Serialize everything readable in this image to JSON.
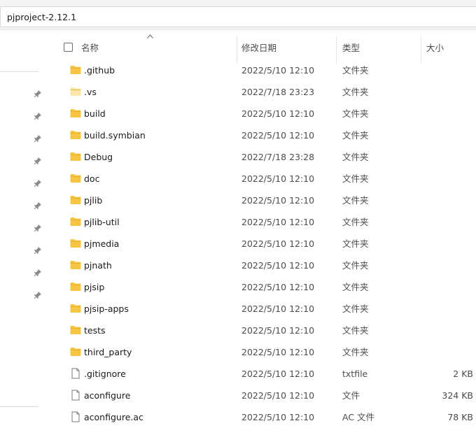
{
  "address": {
    "path": "pjproject-2.12.1"
  },
  "columns": {
    "name": "名称",
    "date": "修改日期",
    "type": "类型",
    "size": "大小"
  },
  "colors": {
    "folder": "#f6c544",
    "folder_light": "#fbe6a8",
    "accent": "#0067c0"
  },
  "rows": [
    {
      "name": ".github",
      "date": "2022/5/10 12:10",
      "type": "文件夹",
      "size": "",
      "icon": "folder-icon"
    },
    {
      "name": ".vs",
      "date": "2022/7/18 23:23",
      "type": "文件夹",
      "size": "",
      "icon": "folder-hidden-icon"
    },
    {
      "name": "build",
      "date": "2022/5/10 12:10",
      "type": "文件夹",
      "size": "",
      "icon": "folder-icon"
    },
    {
      "name": "build.symbian",
      "date": "2022/5/10 12:10",
      "type": "文件夹",
      "size": "",
      "icon": "folder-icon"
    },
    {
      "name": "Debug",
      "date": "2022/7/18 23:28",
      "type": "文件夹",
      "size": "",
      "icon": "folder-icon"
    },
    {
      "name": "doc",
      "date": "2022/5/10 12:10",
      "type": "文件夹",
      "size": "",
      "icon": "folder-icon"
    },
    {
      "name": "pjlib",
      "date": "2022/5/10 12:10",
      "type": "文件夹",
      "size": "",
      "icon": "folder-icon"
    },
    {
      "name": "pjlib-util",
      "date": "2022/5/10 12:10",
      "type": "文件夹",
      "size": "",
      "icon": "folder-icon"
    },
    {
      "name": "pjmedia",
      "date": "2022/5/10 12:10",
      "type": "文件夹",
      "size": "",
      "icon": "folder-icon"
    },
    {
      "name": "pjnath",
      "date": "2022/5/10 12:10",
      "type": "文件夹",
      "size": "",
      "icon": "folder-icon"
    },
    {
      "name": "pjsip",
      "date": "2022/5/10 12:10",
      "type": "文件夹",
      "size": "",
      "icon": "folder-icon"
    },
    {
      "name": "pjsip-apps",
      "date": "2022/5/10 12:10",
      "type": "文件夹",
      "size": "",
      "icon": "folder-icon"
    },
    {
      "name": "tests",
      "date": "2022/5/10 12:10",
      "type": "文件夹",
      "size": "",
      "icon": "folder-icon"
    },
    {
      "name": "third_party",
      "date": "2022/5/10 12:10",
      "type": "文件夹",
      "size": "",
      "icon": "folder-icon"
    },
    {
      "name": ".gitignore",
      "date": "2022/5/10 12:10",
      "type": "txtfile",
      "size": "2 KB",
      "icon": "file-icon"
    },
    {
      "name": "aconfigure",
      "date": "2022/5/10 12:10",
      "type": "文件",
      "size": "324 KB",
      "icon": "file-icon"
    },
    {
      "name": "aconfigure.ac",
      "date": "2022/5/10 12:10",
      "type": "AC 文件",
      "size": "78 KB",
      "icon": "file-icon"
    }
  ]
}
